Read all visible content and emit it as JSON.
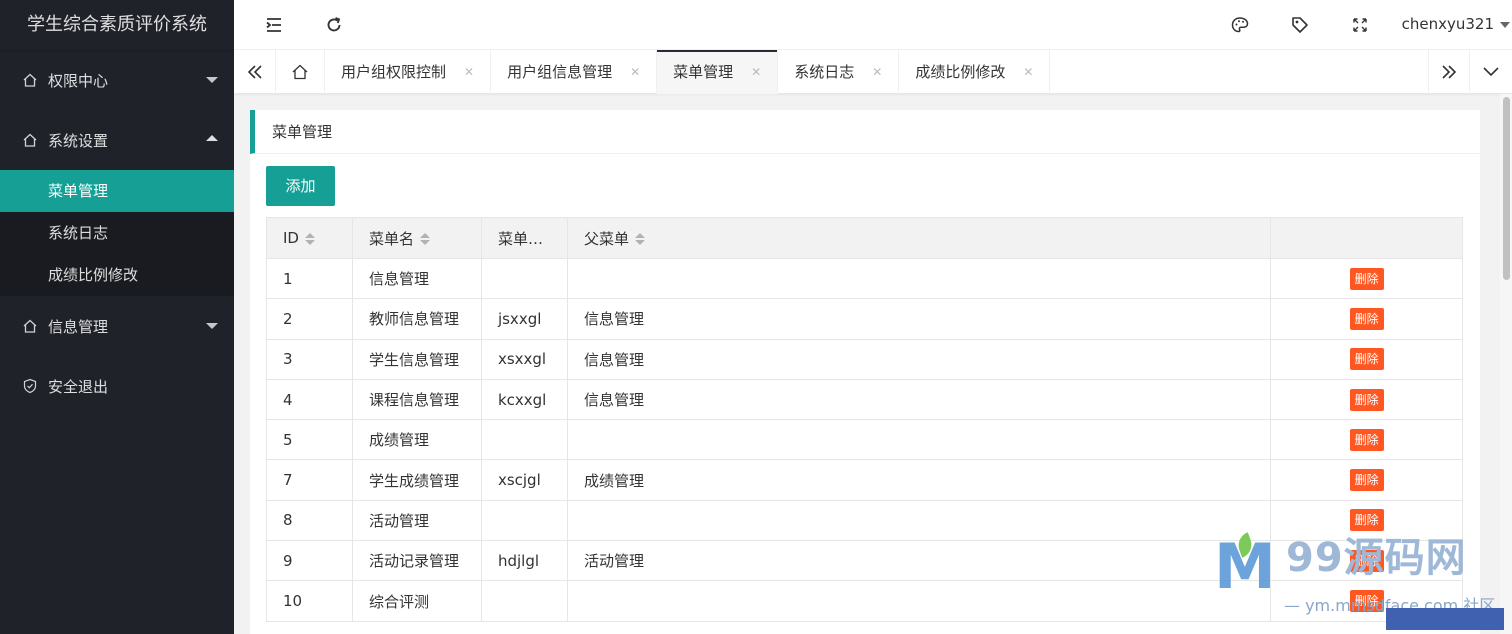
{
  "app": {
    "title": "学生综合素质评价系统"
  },
  "sidebar": {
    "groups": [
      {
        "label": "权限中心"
      },
      {
        "label": "系统设置",
        "items": [
          "菜单管理",
          "系统日志",
          "成绩比例修改"
        ],
        "active_item": "菜单管理"
      },
      {
        "label": "信息管理"
      },
      {
        "label": "安全退出"
      }
    ]
  },
  "header": {
    "icons": [
      "menu-fold-icon",
      "refresh-icon",
      "theme-icon",
      "tag-icon",
      "fullscreen-icon"
    ],
    "user": "chenxyu321"
  },
  "tabs": {
    "items": [
      {
        "label": "用户组权限控制"
      },
      {
        "label": "用户组信息管理"
      },
      {
        "label": "菜单管理"
      },
      {
        "label": "系统日志"
      },
      {
        "label": "成绩比例修改"
      }
    ],
    "active": "菜单管理"
  },
  "card": {
    "title": "菜单管理",
    "add_label": "添加"
  },
  "table": {
    "columns": [
      "ID",
      "菜单名",
      "菜单…",
      "父菜单",
      ""
    ],
    "delete_label": "删除",
    "rows": [
      {
        "id": "1",
        "name": "信息管理",
        "code": "",
        "parent": ""
      },
      {
        "id": "2",
        "name": "教师信息管理",
        "code": "jsxxgl",
        "parent": "信息管理"
      },
      {
        "id": "3",
        "name": "学生信息管理",
        "code": "xsxxgl",
        "parent": "信息管理"
      },
      {
        "id": "4",
        "name": "课程信息管理",
        "code": "kcxxgl",
        "parent": "信息管理"
      },
      {
        "id": "5",
        "name": "成绩管理",
        "code": "",
        "parent": ""
      },
      {
        "id": "7",
        "name": "学生成绩管理",
        "code": "xscjgl",
        "parent": "成绩管理"
      },
      {
        "id": "8",
        "name": "活动管理",
        "code": "",
        "parent": ""
      },
      {
        "id": "9",
        "name": "活动记录管理",
        "code": "hdjlgl",
        "parent": "活动管理"
      },
      {
        "id": "10",
        "name": "综合评测",
        "code": "",
        "parent": ""
      }
    ]
  },
  "watermark": {
    "title": "99源码网",
    "line": "— ym.mmsdface.com 社区"
  },
  "colors": {
    "sidebar_bg": "#20222a",
    "accent": "#16a095",
    "danger": "#ff5722"
  }
}
